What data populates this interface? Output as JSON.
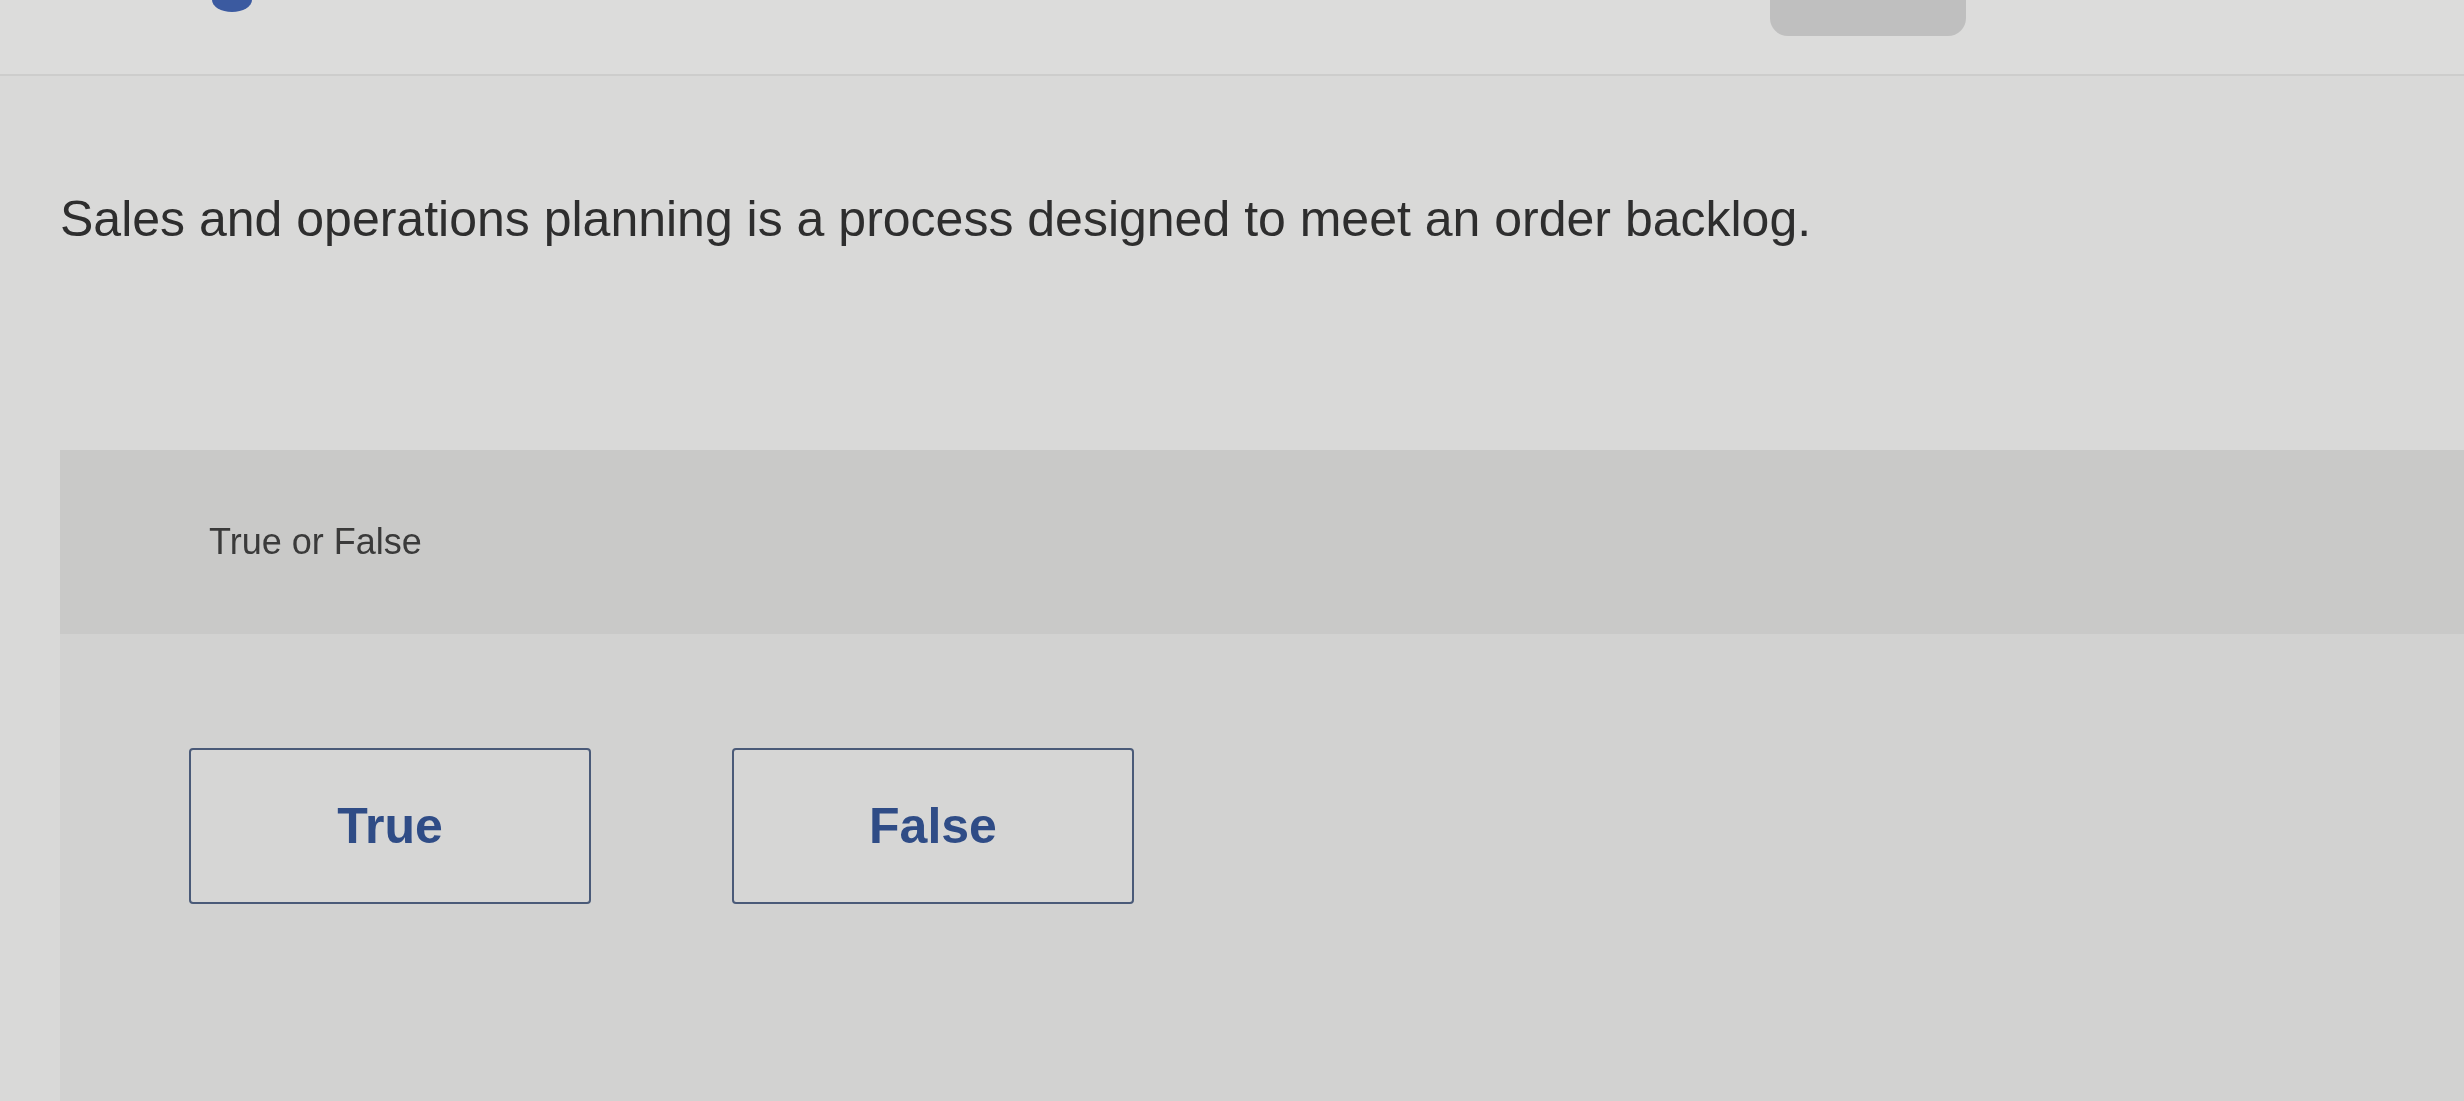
{
  "question": {
    "text": "Sales and operations planning is a process designed to meet an order backlog."
  },
  "answer_panel": {
    "prompt": "True or False",
    "options": [
      {
        "label": "True",
        "selected": false
      },
      {
        "label": "False",
        "selected": false
      }
    ]
  }
}
